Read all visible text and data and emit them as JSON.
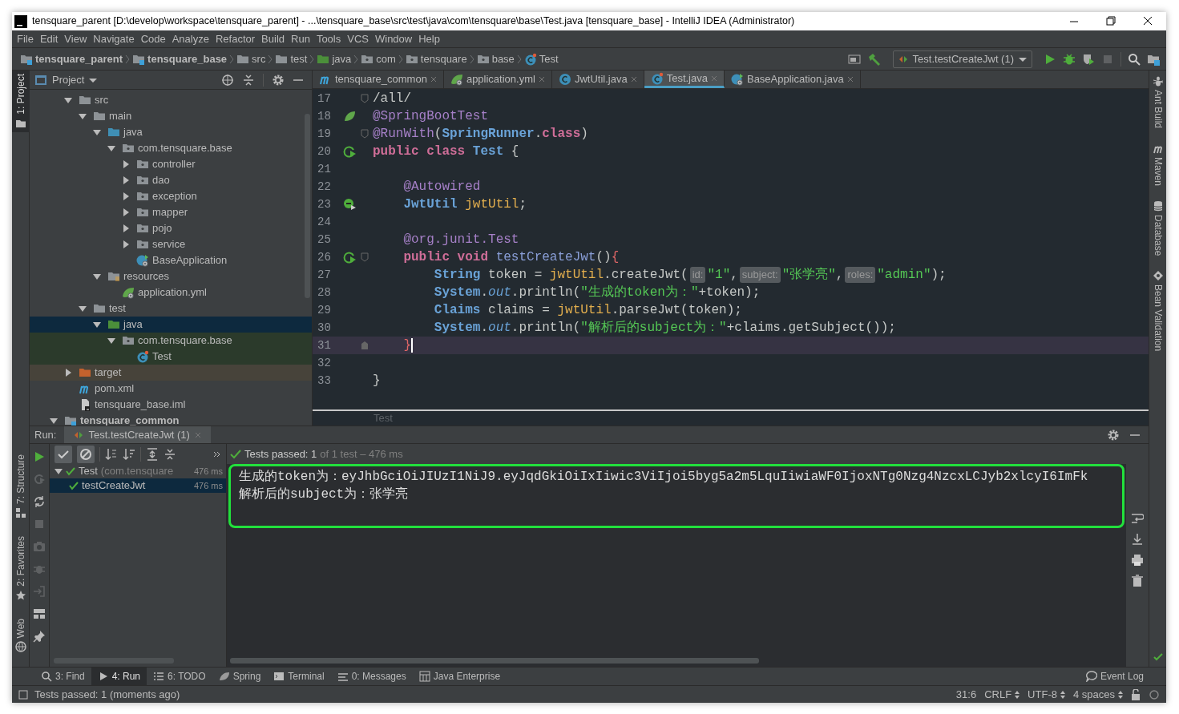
{
  "window": {
    "title": "tensquare_parent [D:\\develop\\workspace\\tensquare_parent] - ...\\tensquare_base\\src\\test\\java\\com\\tensquare\\base\\Test.java [tensquare_base] - IntelliJ IDEA (Administrator)"
  },
  "menu": [
    "File",
    "Edit",
    "View",
    "Navigate",
    "Code",
    "Analyze",
    "Refactor",
    "Build",
    "Run",
    "Tools",
    "VCS",
    "Window",
    "Help"
  ],
  "breadcrumbs": [
    {
      "label": "tensquare_parent",
      "kind": "module"
    },
    {
      "label": "tensquare_base",
      "kind": "module"
    },
    {
      "label": "src",
      "kind": "folder"
    },
    {
      "label": "test",
      "kind": "folder"
    },
    {
      "label": "java",
      "kind": "test-folder"
    },
    {
      "label": "com",
      "kind": "package"
    },
    {
      "label": "tensquare",
      "kind": "package"
    },
    {
      "label": "base",
      "kind": "package"
    },
    {
      "label": "Test",
      "kind": "test-class"
    }
  ],
  "run_config": "Test.testCreateJwt (1)",
  "left_stripe": [
    {
      "label": "1: Project",
      "selected": true,
      "kind": "project"
    },
    {
      "label": "7: Structure",
      "selected": false,
      "kind": "structure"
    },
    {
      "label": "2: Favorites",
      "selected": false,
      "kind": "favorites"
    },
    {
      "label": "Web",
      "selected": false,
      "kind": "web"
    }
  ],
  "right_stripe": [
    {
      "label": "Ant Build",
      "kind": "ant"
    },
    {
      "label": "Maven",
      "kind": "maven"
    },
    {
      "label": "Database",
      "kind": "database"
    },
    {
      "label": "Bean Validation",
      "kind": "bean"
    }
  ],
  "project": {
    "title": "Project",
    "tree": [
      {
        "label": "src",
        "kind": "folder",
        "expanded": true,
        "selected": false,
        "test_scope": false,
        "children": [
          {
            "label": "main",
            "kind": "folder",
            "expanded": true,
            "selected": false,
            "test_scope": false,
            "children": [
              {
                "label": "java",
                "kind": "source-folder",
                "expanded": true,
                "selected": false,
                "test_scope": false,
                "children": [
                  {
                    "label": "com.tensquare.base",
                    "kind": "package",
                    "expanded": true,
                    "selected": false,
                    "test_scope": false,
                    "children": [
                      {
                        "label": "controller",
                        "kind": "package",
                        "expanded": false,
                        "selected": false,
                        "test_scope": false
                      },
                      {
                        "label": "dao",
                        "kind": "package",
                        "expanded": false,
                        "selected": false,
                        "test_scope": false
                      },
                      {
                        "label": "exception",
                        "kind": "package",
                        "expanded": false,
                        "selected": false,
                        "test_scope": false
                      },
                      {
                        "label": "mapper",
                        "kind": "package",
                        "expanded": false,
                        "selected": false,
                        "test_scope": false
                      },
                      {
                        "label": "pojo",
                        "kind": "package",
                        "expanded": false,
                        "selected": false,
                        "test_scope": false
                      },
                      {
                        "label": "service",
                        "kind": "package",
                        "expanded": false,
                        "selected": false,
                        "test_scope": false
                      },
                      {
                        "label": "BaseApplication",
                        "kind": "spring-class",
                        "selected": false,
                        "test_scope": false
                      }
                    ]
                  }
                ]
              },
              {
                "label": "resources",
                "kind": "resources",
                "expanded": true,
                "selected": false,
                "test_scope": false,
                "children": [
                  {
                    "label": "application.yml",
                    "kind": "yml",
                    "selected": false,
                    "test_scope": false
                  }
                ]
              }
            ]
          },
          {
            "label": "test",
            "kind": "folder",
            "expanded": true,
            "selected": false,
            "test_scope": false,
            "children": [
              {
                "label": "java",
                "kind": "test-folder",
                "expanded": true,
                "selected": true,
                "children": [
                  {
                    "label": "com.tensquare.base",
                    "kind": "package",
                    "expanded": true,
                    "selected": false,
                    "test_scope": true,
                    "children": [
                      {
                        "label": "Test",
                        "kind": "test-class",
                        "selected": false,
                        "test_scope": true
                      }
                    ]
                  }
                ]
              }
            ]
          }
        ]
      },
      {
        "label": "target",
        "kind": "excluded",
        "expanded": false,
        "selected": false,
        "test_scope": false
      },
      {
        "label": "pom.xml",
        "kind": "maven",
        "selected": false,
        "test_scope": false
      },
      {
        "label": "tensquare_base.iml",
        "kind": "iml",
        "selected": false,
        "test_scope": false
      }
    ],
    "next_module": {
      "label": "tensquare_common",
      "expanded": true
    }
  },
  "editor_tabs": [
    {
      "label": "tensquare_common",
      "kind": "maven",
      "selected": false
    },
    {
      "label": "application.yml",
      "kind": "yml",
      "selected": false
    },
    {
      "label": "JwtUtil.java",
      "kind": "class",
      "selected": false
    },
    {
      "label": "Test.java",
      "kind": "test-class",
      "selected": true
    },
    {
      "label": "BaseApplication.java",
      "kind": "spring-class",
      "selected": false
    }
  ],
  "code": [
    {
      "number": "17",
      "current": false,
      "marks": [
        {
          "kind": "fold-start"
        }
      ],
      "segments": [
        {
          "t": "/all/",
          "kind": "plain"
        }
      ]
    },
    {
      "number": "18",
      "current": false,
      "marks": [
        {
          "kind": "spring"
        }
      ],
      "segments": [
        {
          "t": "@SpringBootTest",
          "kind": "annotation"
        }
      ]
    },
    {
      "number": "19",
      "current": false,
      "marks": [
        {
          "kind": "fold-start"
        }
      ],
      "segments": [
        {
          "t": "@RunWith",
          "kind": "annotation"
        },
        {
          "t": "(",
          "kind": "plain"
        },
        {
          "t": "SpringRunner",
          "kind": "type"
        },
        {
          "t": ".",
          "kind": "plain"
        },
        {
          "t": "class",
          "kind": "keyword"
        },
        {
          "t": ")",
          "kind": "plain"
        }
      ]
    },
    {
      "number": "20",
      "current": false,
      "marks": [
        {
          "kind": "run"
        }
      ],
      "segments": [
        {
          "t": "public class ",
          "kind": "keyword"
        },
        {
          "t": "Test",
          "kind": "type"
        },
        {
          "t": " {",
          "kind": "plain"
        }
      ]
    },
    {
      "number": "21",
      "current": false
    },
    {
      "number": "22",
      "current": false,
      "segments": [
        {
          "t": "    @Autowired",
          "kind": "annotation"
        }
      ]
    },
    {
      "number": "23",
      "current": false,
      "marks": [
        {
          "kind": "bean"
        }
      ],
      "segments": [
        {
          "t": "    JwtUtil",
          "kind": "type"
        },
        {
          "t": " jwtUtil",
          "kind": "field"
        },
        {
          "t": ";",
          "kind": "plain"
        }
      ]
    },
    {
      "number": "24",
      "current": false
    },
    {
      "number": "25",
      "current": false,
      "segments": [
        {
          "t": "    @org.junit.Test",
          "kind": "annotation"
        }
      ]
    },
    {
      "number": "26",
      "current": false,
      "marks": [
        {
          "kind": "run"
        },
        {
          "kind": "fold-start"
        }
      ],
      "segments": [
        {
          "t": "    public void ",
          "kind": "keyword"
        },
        {
          "t": "testCreateJwt",
          "kind": "method"
        },
        {
          "t": "()",
          "kind": "plain"
        },
        {
          "t": "{",
          "kind": "brace"
        }
      ]
    },
    {
      "number": "27",
      "current": false,
      "segments": [
        {
          "t": "        String",
          "kind": "type"
        },
        {
          "t": " token = ",
          "kind": "plain"
        },
        {
          "t": "jwtUtil",
          "kind": "field"
        },
        {
          "t": ".createJwt(",
          "kind": "plain"
        },
        {
          "t": "id:",
          "kind": "hint"
        },
        {
          "t": "\"1\"",
          "kind": "string"
        },
        {
          "t": ",",
          "kind": "plain"
        },
        {
          "t": "subject:",
          "kind": "hint"
        },
        {
          "t": "\"张学亮\"",
          "kind": "string"
        },
        {
          "t": ",",
          "kind": "plain"
        },
        {
          "t": "roles:",
          "kind": "hint"
        },
        {
          "t": "\"admin\"",
          "kind": "string"
        },
        {
          "t": ");",
          "kind": "plain"
        }
      ]
    },
    {
      "number": "28",
      "current": false,
      "segments": [
        {
          "t": "        System",
          "kind": "type"
        },
        {
          "t": ".",
          "kind": "plain"
        },
        {
          "t": "out",
          "kind": "static"
        },
        {
          "t": ".println(",
          "kind": "plain"
        },
        {
          "t": "\"生成的token为：\"",
          "kind": "string"
        },
        {
          "t": "+token);",
          "kind": "plain"
        }
      ]
    },
    {
      "number": "29",
      "current": false,
      "segments": [
        {
          "t": "        Claims",
          "kind": "type"
        },
        {
          "t": " claims = ",
          "kind": "plain"
        },
        {
          "t": "jwtUtil",
          "kind": "field"
        },
        {
          "t": ".parseJwt(token);",
          "kind": "plain"
        }
      ]
    },
    {
      "number": "30",
      "current": false,
      "segments": [
        {
          "t": "        System",
          "kind": "type"
        },
        {
          "t": ".",
          "kind": "plain"
        },
        {
          "t": "out",
          "kind": "static"
        },
        {
          "t": ".println(",
          "kind": "plain"
        },
        {
          "t": "\"解析后的subject为：\"",
          "kind": "string"
        },
        {
          "t": "+claims.getSubject());",
          "kind": "plain"
        }
      ]
    },
    {
      "number": "31",
      "current": true,
      "marks": [
        {
          "kind": "fold-end"
        }
      ],
      "segments": [
        {
          "t": "    }",
          "kind": "brace"
        }
      ]
    },
    {
      "number": "32",
      "current": false
    },
    {
      "number": "33",
      "current": false,
      "segments": [
        {
          "t": "}",
          "kind": "plain"
        }
      ]
    }
  ],
  "editor_breadcrumb": "Test",
  "run": {
    "label": "Run:",
    "tab": "Test.testCreateJwt (1)",
    "show_passed": true,
    "show_ignored": true,
    "summary": "Tests passed: 1",
    "summary_detail": "of 1 test – 476 ms",
    "tests": [
      {
        "label": "Test",
        "detail": "(com.tensquare",
        "time": "476 ms",
        "expanded": true,
        "selected": false,
        "children": [
          {
            "label": "testCreateJwt",
            "time": "476 ms",
            "selected": true
          }
        ]
      }
    ],
    "console": [
      "生成的token为：eyJhbGciOiJIUzI1NiJ9.eyJqdGkiOiIxIiwic3ViIjoi5byg5a2m5LquIiwiaWF0IjoxNTg0Nzg4NzcxLCJyb2xlcyI6ImFk",
      "解析后的subject为：张学亮"
    ]
  },
  "tool_buttons": [
    {
      "label": "3: Find",
      "kind": "find",
      "selected": false
    },
    {
      "label": "4: Run",
      "kind": "run",
      "selected": true
    },
    {
      "label": "6: TODO",
      "kind": "todo",
      "selected": false
    },
    {
      "label": "Spring",
      "kind": "spring",
      "selected": false
    },
    {
      "label": "Terminal",
      "kind": "terminal",
      "selected": false
    },
    {
      "label": "0: Messages",
      "kind": "messages",
      "selected": false
    },
    {
      "label": "Java Enterprise",
      "kind": "javaee",
      "selected": false
    }
  ],
  "event_log": "Event Log",
  "status": {
    "message": "Tests passed: 1 (moments ago)",
    "position": "31:6",
    "line_separator": "CRLF",
    "encoding": "UTF-8",
    "indent": "4 spaces"
  }
}
